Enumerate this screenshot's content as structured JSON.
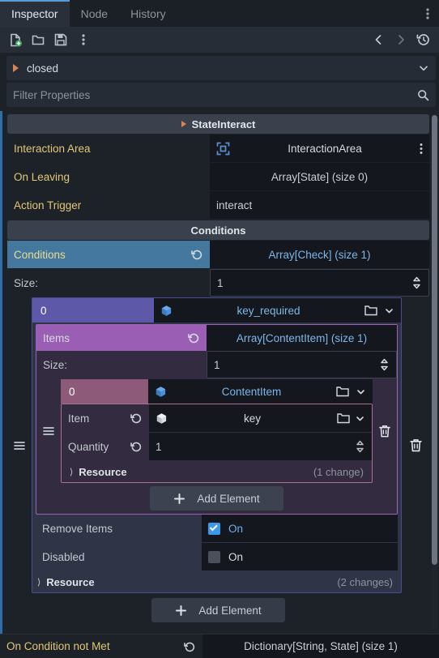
{
  "tabs": [
    {
      "label": "Inspector",
      "active": true
    },
    {
      "label": "Node",
      "active": false
    },
    {
      "label": "History",
      "active": false
    }
  ],
  "tabbar": {
    "menu_icon": "vertical-dots-icon"
  },
  "toolbar": {
    "new_resource": "new-resource-icon",
    "open_resource": "folder-open-icon",
    "save_resource": "save-icon",
    "more_menu": "vertical-dots-icon",
    "back": "chevron-left-icon",
    "forward": "chevron-right-icon",
    "history": "history-icon"
  },
  "object_row": {
    "label": "closed",
    "expand_icon": "triangle-right-icon",
    "dropdown_icon": "chevron-down-icon",
    "side_icon": "doc-search-icon"
  },
  "filter": {
    "placeholder": "Filter Properties",
    "value": "",
    "search_icon": "search-icon",
    "tools_icon": "tools-icon"
  },
  "colors": {
    "accent_blue": "#44789e",
    "nest1_border": "#4b4e8e",
    "nest2_border": "#9a63b4",
    "nest3_border": "#a8718f",
    "index_purple": "#5d58a8",
    "index_mauve": "#8d5a79",
    "items_header": "#9a5fb4",
    "checkbox_on": "#3a9ae8",
    "resource_text": "#7eb6e8",
    "property_name": "#e0c878"
  },
  "inspector": {
    "state_category": {
      "label": "StateInteract",
      "expand_icon": "triangle-right-icon"
    },
    "interaction_area": {
      "name": "Interaction Area",
      "value": "InteractionArea",
      "icon": "node-picker-icon",
      "menu_icon": "vertical-dots-icon"
    },
    "on_leaving": {
      "name": "On Leaving",
      "value": "Array[State] (size 0)"
    },
    "action_trigger": {
      "name": "Action Trigger",
      "value": "interact"
    },
    "conditions_category": {
      "label": "Conditions"
    },
    "conditions": {
      "name": "Conditions",
      "value": "Array[Check] (size 1)",
      "revert_icon": "revert-icon",
      "size_label": "Size:",
      "size_value": "1",
      "element": {
        "index": "0",
        "resource_name": "key_required",
        "resource_icon": "resource-cube-icon",
        "folder_icon": "folder-open-icon",
        "dropdown_icon": "chevron-down-icon",
        "drag_icon": "drag-handle-icon",
        "trash_icon": "trash-icon",
        "items": {
          "name": "Items",
          "value": "Array[ContentItem] (size 1)",
          "revert_icon": "revert-icon",
          "size_label": "Size:",
          "size_value": "1",
          "element": {
            "index": "0",
            "resource_name": "ContentItem",
            "resource_icon": "resource-cube-icon",
            "folder_icon": "folder-open-icon",
            "dropdown_icon": "chevron-down-icon",
            "drag_icon": "drag-handle-icon",
            "trash_icon": "trash-icon",
            "item": {
              "name": "Item",
              "value": "key",
              "resource_icon": "resource-cube-icon",
              "folder_icon": "folder-open-icon",
              "dropdown_icon": "chevron-down-icon",
              "revert_icon": "revert-icon"
            },
            "quantity": {
              "name": "Quantity",
              "value": "1",
              "revert_icon": "revert-icon",
              "spinner_icon": "updown-arrows-icon"
            },
            "resource_sub": {
              "label": "Resource",
              "changes": "(1 change)",
              "chevron": "chevron-right-icon"
            }
          },
          "add_element": {
            "label": "Add Element",
            "icon": "plus-icon"
          }
        },
        "remove_items": {
          "name": "Remove Items",
          "value": "On",
          "checked": true
        },
        "disabled": {
          "name": "Disabled",
          "value": "On",
          "checked": false
        },
        "resource_sub": {
          "label": "Resource",
          "changes": "(2 changes)",
          "chevron": "chevron-right-icon"
        }
      },
      "add_element": {
        "label": "Add Element",
        "icon": "plus-icon"
      }
    },
    "on_condition_not_met": {
      "name": "On Condition not Met",
      "value": "Dictionary[String, State] (size 1)",
      "revert_icon": "revert-icon"
    }
  }
}
